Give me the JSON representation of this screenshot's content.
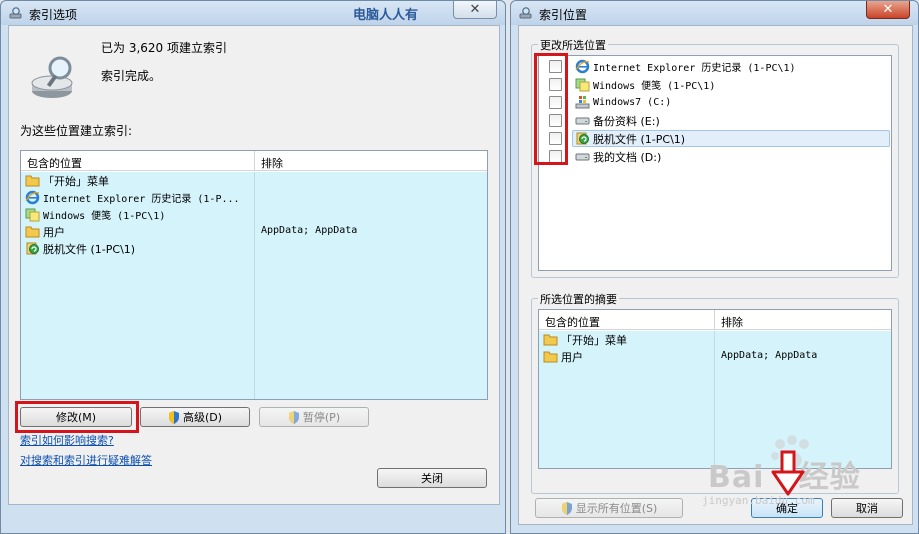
{
  "left_window": {
    "title": "索引选项",
    "watermark": "电脑人人有",
    "status_count": "已为 3,620 项建立索引",
    "status_done": "索引完成。",
    "section_label": "为这些位置建立索引:",
    "columns": {
      "included": "包含的位置",
      "excluded": "排除"
    },
    "rows": [
      {
        "label": "「开始」菜单",
        "icon": "folder-icon",
        "exclude": ""
      },
      {
        "label": "Internet Explorer 历史记录 (1-P...",
        "icon": "internet-explorer-icon",
        "exclude": ""
      },
      {
        "label": "Windows 便笺 (1-PC\\1)",
        "icon": "sticky-notes-icon",
        "exclude": ""
      },
      {
        "label": "用户",
        "icon": "folder-icon",
        "exclude": "AppData; AppData"
      },
      {
        "label": "脱机文件 (1-PC\\1)",
        "icon": "offline-files-icon",
        "exclude": ""
      }
    ],
    "buttons": {
      "modify": "修改(M)",
      "advanced": "高级(D)",
      "pause": "暂停(P)",
      "close": "关闭"
    },
    "links": {
      "how_affects": "索引如何影响搜索?",
      "troubleshoot": "对搜索和索引进行疑难解答"
    }
  },
  "right_window": {
    "title": "索引位置",
    "change_group_label": "更改所选位置",
    "locations": [
      {
        "label": "Internet Explorer 历史记录 (1-PC\\1)",
        "icon": "internet-explorer-icon",
        "checked": false
      },
      {
        "label": "Windows 便笺 (1-PC\\1)",
        "icon": "sticky-notes-icon",
        "checked": false
      },
      {
        "label": "Windows7 (C:)",
        "icon": "windows-drive-icon",
        "checked": false
      },
      {
        "label": "备份资料 (E:)",
        "icon": "drive-icon",
        "checked": false
      },
      {
        "label": "脱机文件 (1-PC\\1)",
        "icon": "offline-files-icon",
        "checked": false
      },
      {
        "label": "我的文档 (D:)",
        "icon": "drive-icon",
        "checked": false
      }
    ],
    "summary_group_label": "所选位置的摘要",
    "columns": {
      "included": "包含的位置",
      "excluded": "排除"
    },
    "summary_rows": [
      {
        "label": "「开始」菜单",
        "icon": "folder-icon",
        "exclude": ""
      },
      {
        "label": "用户",
        "icon": "folder-icon",
        "exclude": "AppData; AppData"
      }
    ],
    "buttons": {
      "show_all": "显示所有位置(S)",
      "ok": "确定",
      "cancel": "取消"
    }
  },
  "watermark_brand": {
    "text": "Bai",
    "text2": "经验",
    "sub": "jingyan.baidu.com"
  },
  "colors": {
    "highlight_red": "#d4151b",
    "list_bg": "#d5f3fb",
    "link": "#0a4fb0"
  }
}
